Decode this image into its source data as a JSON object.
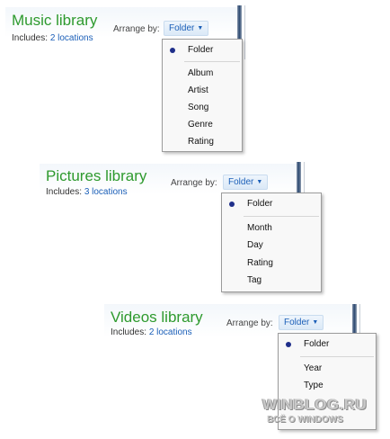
{
  "music": {
    "title": "Music library",
    "includes_label": "Includes:",
    "includes_link": "2 locations",
    "arrange_label": "Arrange by:",
    "arrange_value": "Folder",
    "menu": [
      "Folder",
      "Album",
      "Artist",
      "Song",
      "Genre",
      "Rating"
    ],
    "selected": "Folder"
  },
  "pictures": {
    "title": "Pictures library",
    "includes_label": "Includes:",
    "includes_link": "3 locations",
    "arrange_label": "Arrange by:",
    "arrange_value": "Folder",
    "menu": [
      "Folder",
      "Month",
      "Day",
      "Rating",
      "Tag"
    ],
    "selected": "Folder"
  },
  "videos": {
    "title": "Videos library",
    "includes_label": "Includes:",
    "includes_link": "2 locations",
    "arrange_label": "Arrange by:",
    "arrange_value": "Folder",
    "menu": [
      "Folder",
      "Year",
      "Type"
    ],
    "selected": "Folder"
  },
  "watermark": {
    "line1": "WINBLOG.RU",
    "line2": "ВСЁ О WINDOWS"
  },
  "colors": {
    "title_green": "#2e9a2e",
    "link_blue": "#1b5fb8",
    "bullet": "#1f2f8a"
  },
  "icons": {
    "dropdown_caret": "▼",
    "radio_bullet": "●"
  }
}
